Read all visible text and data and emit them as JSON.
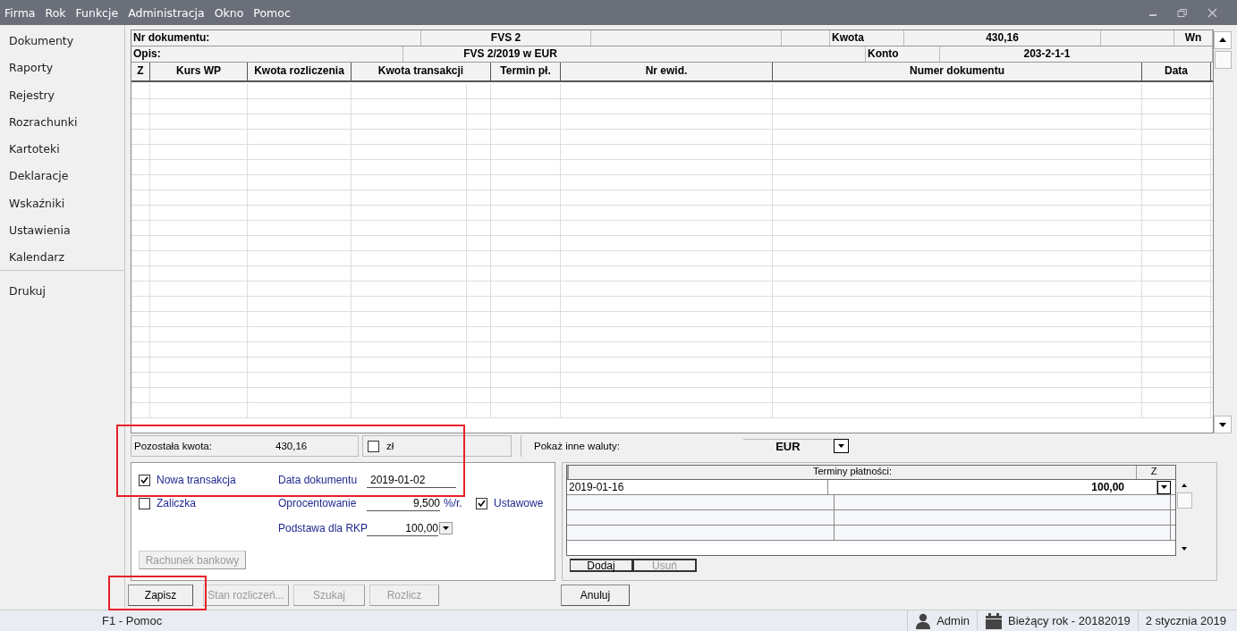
{
  "menu": [
    "Firma",
    "Rok",
    "Funkcje",
    "Administracja",
    "Okno",
    "Pomoc"
  ],
  "sidebar": {
    "items": [
      "Dokumenty",
      "Raporty",
      "Rejestry",
      "Rozrachunki",
      "Kartoteki",
      "Deklaracje",
      "Wskaźniki",
      "Ustawienia",
      "Kalendarz"
    ],
    "footer_items": [
      "Drukuj"
    ]
  },
  "document": {
    "number_label": "Nr dokumentu:",
    "number": "FVS 2",
    "amount_label": "Kwota",
    "amount": "430,16",
    "side": "Wn",
    "description_label": "Opis:",
    "description": "FVS  2/2019 w EUR",
    "account_label": "Konto",
    "account": "203-2-1-1"
  },
  "table": {
    "columns": [
      "Z",
      "Kurs WP",
      "Kwota rozliczenia",
      "Kwota transakcji",
      "Termin pł.",
      "Nr ewid.",
      "Numer dokumentu",
      "Data"
    ]
  },
  "summary": {
    "remaining_label": "Pozostała kwota:",
    "remaining": "430,16",
    "pln": {
      "label": "zł",
      "checked": false
    },
    "other_currencies_label": "Pokaż inne waluty:",
    "currency": "EUR"
  },
  "form": {
    "new_transaction": {
      "label": "Nowa transakcja",
      "checked": true
    },
    "advance": {
      "label": "Zaliczka",
      "checked": false
    },
    "doc_date_label": "Data dokumentu",
    "doc_date": "2019-01-02",
    "interest_label": "Oprocentowanie",
    "interest": "9,500",
    "interest_unit": "%/r.",
    "statutory": {
      "label": "Ustawowe",
      "checked": true
    },
    "rkp_label": "Podstawa dla RKP",
    "rkp": "100,00",
    "bank_button": {
      "label": "Rachunek bankowy",
      "disabled": true
    }
  },
  "payment_terms": {
    "title": "Terminy płatności:",
    "z_label": "Z",
    "rows": [
      {
        "date": "2019-01-16",
        "amount": "100,00"
      }
    ],
    "buttons": [
      {
        "label": "Dodaj",
        "disabled": false
      },
      {
        "label": "Usuń",
        "disabled": true
      }
    ]
  },
  "buttons": [
    {
      "label": "Zapisz",
      "disabled": false
    },
    {
      "label": "Stan rozliczeń...",
      "disabled": true
    },
    {
      "label": "Szukaj",
      "disabled": true
    },
    {
      "label": "Rozlicz",
      "disabled": true
    }
  ],
  "cancel_button": {
    "label": "Anuluj",
    "disabled": false
  },
  "status_bar": {
    "help": "F1 - Pomoc",
    "user": "Admin",
    "year": "Bieżący rok - 20182019",
    "date": "2 stycznia 2019"
  },
  "annotations": [
    {
      "kind": "highlight"
    },
    {
      "kind": "highlight"
    }
  ]
}
